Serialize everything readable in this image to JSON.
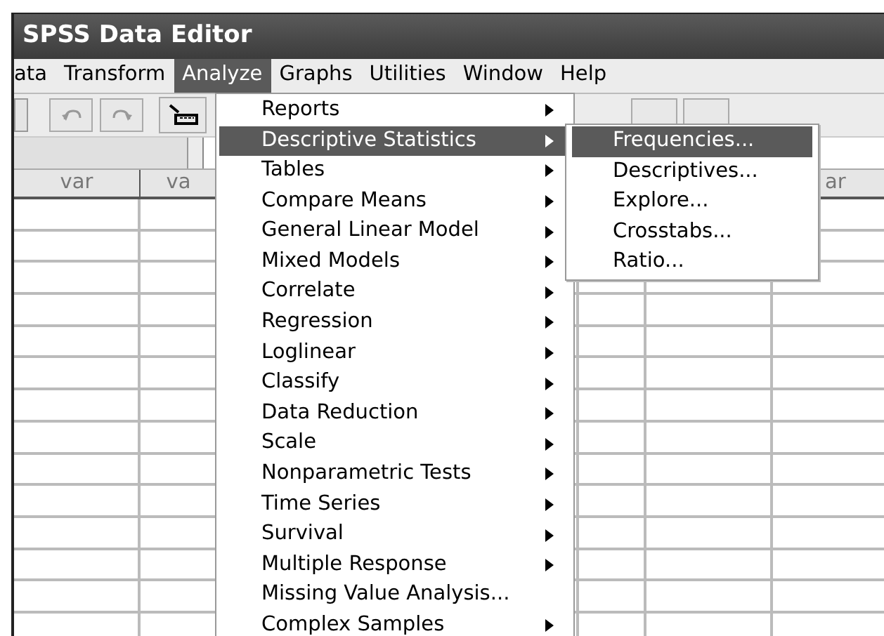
{
  "window": {
    "title": "SPSS Data Editor"
  },
  "menu_bar": [
    {
      "label": "ata",
      "selected": false
    },
    {
      "label": "Transform",
      "selected": false
    },
    {
      "label": "Analyze",
      "selected": true
    },
    {
      "label": "Graphs",
      "selected": false
    },
    {
      "label": "Utilities",
      "selected": false
    },
    {
      "label": "Window",
      "selected": false
    },
    {
      "label": "Help",
      "selected": false
    }
  ],
  "grid": {
    "left_headers": [
      "var",
      "va"
    ],
    "right_header": "ar"
  },
  "analyze_menu": [
    {
      "label": "Reports",
      "submenu": true,
      "selected": false
    },
    {
      "label": "Descriptive Statistics",
      "submenu": true,
      "selected": true
    },
    {
      "label": "Tables",
      "submenu": true,
      "selected": false
    },
    {
      "label": "Compare Means",
      "submenu": true,
      "selected": false
    },
    {
      "label": "General Linear Model",
      "submenu": true,
      "selected": false
    },
    {
      "label": "Mixed Models",
      "submenu": true,
      "selected": false
    },
    {
      "label": "Correlate",
      "submenu": true,
      "selected": false
    },
    {
      "label": "Regression",
      "submenu": true,
      "selected": false
    },
    {
      "label": "Loglinear",
      "submenu": true,
      "selected": false
    },
    {
      "label": "Classify",
      "submenu": true,
      "selected": false
    },
    {
      "label": "Data Reduction",
      "submenu": true,
      "selected": false
    },
    {
      "label": "Scale",
      "submenu": true,
      "selected": false
    },
    {
      "label": "Nonparametric Tests",
      "submenu": true,
      "selected": false
    },
    {
      "label": "Time Series",
      "submenu": true,
      "selected": false
    },
    {
      "label": "Survival",
      "submenu": true,
      "selected": false
    },
    {
      "label": "Multiple Response",
      "submenu": true,
      "selected": false
    },
    {
      "label": "Missing Value Analysis...",
      "submenu": false,
      "selected": false
    },
    {
      "label": "Complex Samples",
      "submenu": true,
      "selected": false
    }
  ],
  "descriptive_submenu": [
    {
      "label": "Frequencies...",
      "selected": true
    },
    {
      "label": "Descriptives...",
      "selected": false
    },
    {
      "label": "Explore...",
      "selected": false
    },
    {
      "label": "Crosstabs...",
      "selected": false
    },
    {
      "label": "Ratio...",
      "selected": false
    }
  ]
}
